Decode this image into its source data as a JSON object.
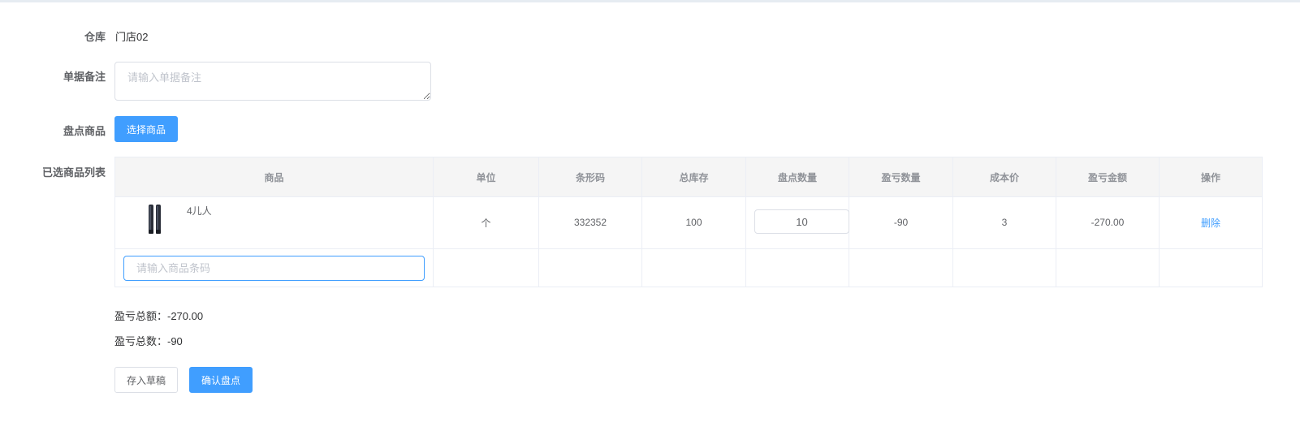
{
  "form": {
    "warehouse_label": "仓库",
    "warehouse_value": "门店02",
    "remark_label": "单据备注",
    "remark_placeholder": "请输入单据备注",
    "remark_value": "",
    "goods_label": "盘点商品",
    "select_goods_button": "选择商品",
    "list_label": "已选商品列表"
  },
  "table": {
    "headers": [
      "商品",
      "单位",
      "条形码",
      "总库存",
      "盘点数量",
      "盈亏数量",
      "成本价",
      "盈亏金额",
      "操作"
    ],
    "rows": [
      {
        "product_name": "4儿人",
        "unit": "个",
        "barcode": "332352",
        "total_stock": "100",
        "count_qty": "10",
        "diff_qty": "-90",
        "cost_price": "3",
        "diff_amount": "-270.00",
        "action": "删除"
      }
    ],
    "barcode_placeholder": "请输入商品条码"
  },
  "summary": {
    "total_amount": "盈亏总额：-270.00",
    "total_qty": "盈亏总数：-90"
  },
  "actions": {
    "save_draft": "存入草稿",
    "confirm": "确认盘点"
  },
  "colors": {
    "primary": "#409eff",
    "border": "#dcdfe6",
    "header_bg": "#f5f5f5"
  }
}
